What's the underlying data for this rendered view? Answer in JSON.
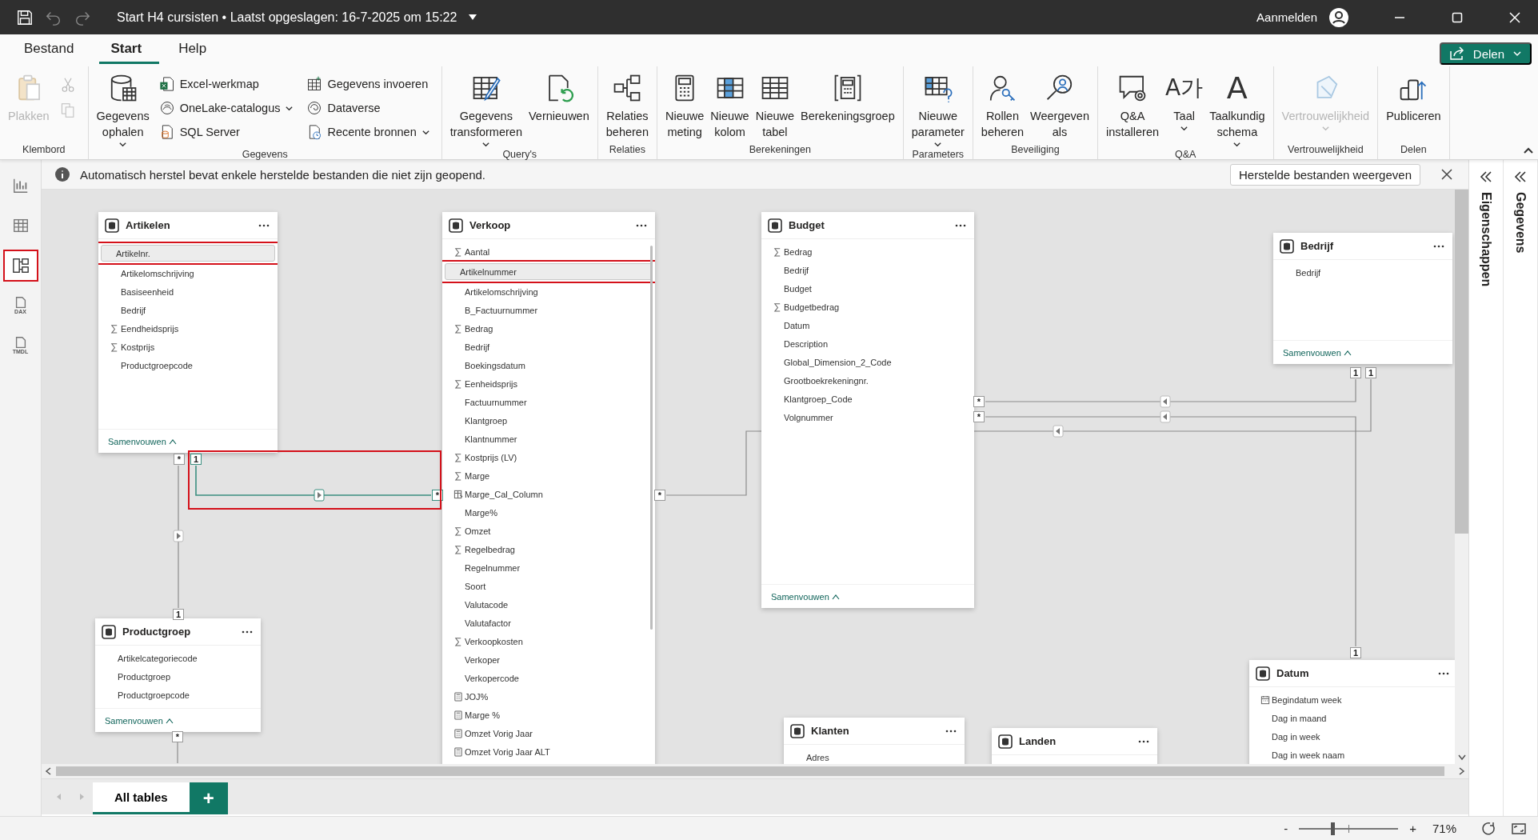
{
  "title_bar": {
    "title": "Start H4 cursisten • Laatst opgeslagen: 16-7-2025 om 15:22",
    "account": "Aanmelden"
  },
  "menu_tabs": [
    {
      "label": "Bestand",
      "selected": false
    },
    {
      "label": "Start",
      "selected": true
    },
    {
      "label": "Help",
      "selected": false
    }
  ],
  "share_button": "Delen",
  "ribbon": [
    {
      "label": "Klembord",
      "items": [
        {
          "kind": "large",
          "label": "Plakken",
          "disabled": true
        },
        {
          "kind": "column",
          "buttons": [
            {
              "disabled": true
            },
            {
              "disabled": true
            }
          ]
        }
      ]
    },
    {
      "label": "Gegevens",
      "items": [
        {
          "kind": "large",
          "label": "Gegevens\nophalen",
          "dropdown": true
        },
        {
          "kind": "column",
          "buttons": [
            {
              "label": "Excel-werkmap"
            },
            {
              "label": "OneLake-catalogus",
              "dropdown": true
            },
            {
              "label": "SQL Server"
            }
          ]
        },
        {
          "kind": "column",
          "buttons": [
            {
              "label": "Gegevens invoeren"
            },
            {
              "label": "Dataverse"
            },
            {
              "label": "Recente bronnen",
              "dropdown": true
            }
          ]
        }
      ]
    },
    {
      "label": "Query's",
      "items": [
        {
          "kind": "large",
          "label": "Gegevens\ntransformeren",
          "dropdown": true
        },
        {
          "kind": "large",
          "label": "Vernieuwen"
        }
      ]
    },
    {
      "label": "Relaties",
      "items": [
        {
          "kind": "large",
          "label": "Relaties\nbeheren"
        }
      ]
    },
    {
      "label": "Berekeningen",
      "items": [
        {
          "kind": "large",
          "label": "Nieuwe\nmeting"
        },
        {
          "kind": "large",
          "label": "Nieuwe\nkolom"
        },
        {
          "kind": "large",
          "label": "Nieuwe\ntabel"
        },
        {
          "kind": "large",
          "label": "Berekeningsgroep"
        }
      ]
    },
    {
      "label": "Parameters",
      "items": [
        {
          "kind": "large",
          "label": "Nieuwe\nparameter",
          "dropdown": true
        }
      ]
    },
    {
      "label": "Beveiliging",
      "items": [
        {
          "kind": "large",
          "label": "Rollen\nbeheren"
        },
        {
          "kind": "large",
          "label": "Weergeven\nals"
        }
      ]
    },
    {
      "label": "Q&A",
      "items": [
        {
          "kind": "large",
          "label": "Q&A\ninstalleren"
        },
        {
          "kind": "large",
          "label": "Taal",
          "glyph": "A가",
          "dropdown": true
        },
        {
          "kind": "large",
          "label": "Taalkundig\nschema",
          "glyph": "A",
          "dropdown": true
        }
      ]
    },
    {
      "label": "Vertrouwelijkheid",
      "items": [
        {
          "kind": "large",
          "label": "Vertrouwelijkheid",
          "dropdown": true,
          "disabled": true
        }
      ]
    },
    {
      "label": "Delen",
      "items": [
        {
          "kind": "large",
          "label": "Publiceren"
        }
      ]
    }
  ],
  "rail": [
    {
      "selected": false,
      "marked": false
    },
    {
      "selected": false,
      "marked": false
    },
    {
      "selected": true,
      "marked": true
    },
    {
      "label": "DAX",
      "selected": false,
      "marked": false
    },
    {
      "label": "TMDL",
      "selected": false,
      "marked": false
    }
  ],
  "notification": {
    "message": "Automatisch herstel bevat enkele herstelde bestanden die niet zijn geopend.",
    "action": "Herstelde bestanden weergeven"
  },
  "side_panels": [
    {
      "label": "Eigenschappen"
    },
    {
      "label": "Gegevens"
    }
  ],
  "tables": [
    {
      "name": "Artikelen",
      "collapse": "Samenvouwen",
      "fields": [
        {
          "name": "Artikelnr.",
          "kind": "plain",
          "selected": true,
          "marked": true
        },
        {
          "name": "Artikelomschrijving",
          "kind": "plain",
          "selected": false,
          "marked": false
        },
        {
          "name": "Basiseenheid",
          "kind": "plain",
          "selected": false,
          "marked": false
        },
        {
          "name": "Bedrijf",
          "kind": "plain",
          "selected": false,
          "marked": false
        },
        {
          "name": "Eendheidsprijs",
          "kind": "sum",
          "selected": false,
          "marked": false
        },
        {
          "name": "Kostprijs",
          "kind": "sum",
          "selected": false,
          "marked": false
        },
        {
          "name": "Productgroepcode",
          "kind": "plain",
          "selected": false,
          "marked": false
        }
      ]
    },
    {
      "name": "Verkoop",
      "fields": [
        {
          "name": "Aantal",
          "kind": "sum",
          "selected": false,
          "marked": false
        },
        {
          "name": "Artikelnummer",
          "kind": "plain",
          "selected": true,
          "marked": true
        },
        {
          "name": "Artikelomschrijving",
          "kind": "plain",
          "selected": false,
          "marked": false
        },
        {
          "name": "B_Factuurnummer",
          "kind": "plain",
          "selected": false,
          "marked": false
        },
        {
          "name": "Bedrag",
          "kind": "sum",
          "selected": false,
          "marked": false
        },
        {
          "name": "Bedrijf",
          "kind": "plain",
          "selected": false,
          "marked": false
        },
        {
          "name": "Boekingsdatum",
          "kind": "plain",
          "selected": false,
          "marked": false
        },
        {
          "name": "Eenheidsprijs",
          "kind": "sum",
          "selected": false,
          "marked": false
        },
        {
          "name": "Factuurnummer",
          "kind": "plain",
          "selected": false,
          "marked": false
        },
        {
          "name": "Klantgroep",
          "kind": "plain",
          "selected": false,
          "marked": false
        },
        {
          "name": "Klantnummer",
          "kind": "plain",
          "selected": false,
          "marked": false
        },
        {
          "name": "Kostprijs (LV)",
          "kind": "sum",
          "selected": false,
          "marked": false
        },
        {
          "name": "Marge",
          "kind": "sum",
          "selected": false,
          "marked": false
        },
        {
          "name": "Marge_Cal_Column",
          "kind": "calc",
          "selected": false,
          "marked": false
        },
        {
          "name": "Marge%",
          "kind": "plain",
          "selected": false,
          "marked": false
        },
        {
          "name": "Omzet",
          "kind": "sum",
          "selected": false,
          "marked": false
        },
        {
          "name": "Regelbedrag",
          "kind": "sum",
          "selected": false,
          "marked": false
        },
        {
          "name": "Regelnummer",
          "kind": "plain",
          "selected": false,
          "marked": false
        },
        {
          "name": "Soort",
          "kind": "plain",
          "selected": false,
          "marked": false
        },
        {
          "name": "Valutacode",
          "kind": "plain",
          "selected": false,
          "marked": false
        },
        {
          "name": "Valutafactor",
          "kind": "plain",
          "selected": false,
          "marked": false
        },
        {
          "name": "Verkoopkosten",
          "kind": "sum",
          "selected": false,
          "marked": false
        },
        {
          "name": "Verkoper",
          "kind": "plain",
          "selected": false,
          "marked": false
        },
        {
          "name": "Verkopercode",
          "kind": "plain",
          "selected": false,
          "marked": false
        },
        {
          "name": "JOJ%",
          "kind": "measure",
          "selected": false,
          "marked": false
        },
        {
          "name": "Marge %",
          "kind": "measure",
          "selected": false,
          "marked": false
        },
        {
          "name": "Omzet Vorig Jaar",
          "kind": "measure",
          "selected": false,
          "marked": false
        },
        {
          "name": "Omzet Vorig Jaar ALT",
          "kind": "measure",
          "selected": false,
          "marked": false
        }
      ]
    },
    {
      "name": "Budget",
      "collapse": "Samenvouwen",
      "fields": [
        {
          "name": "Bedrag",
          "kind": "sum",
          "selected": false,
          "marked": false
        },
        {
          "name": "Bedrijf",
          "kind": "plain",
          "selected": false,
          "marked": false
        },
        {
          "name": "Budget",
          "kind": "plain",
          "selected": false,
          "marked": false
        },
        {
          "name": "Budgetbedrag",
          "kind": "sum",
          "selected": false,
          "marked": false
        },
        {
          "name": "Datum",
          "kind": "plain",
          "selected": false,
          "marked": false
        },
        {
          "name": "Description",
          "kind": "plain",
          "selected": false,
          "marked": false
        },
        {
          "name": "Global_Dimension_2_Code",
          "kind": "plain",
          "selected": false,
          "marked": false
        },
        {
          "name": "Grootboekrekeningnr.",
          "kind": "plain",
          "selected": false,
          "marked": false
        },
        {
          "name": "Klantgroep_Code",
          "kind": "plain",
          "selected": false,
          "marked": false
        },
        {
          "name": "Volgnummer",
          "kind": "plain",
          "selected": false,
          "marked": false
        }
      ]
    },
    {
      "name": "Bedrijf",
      "collapse": "Samenvouwen",
      "fields": [
        {
          "name": "Bedrijf",
          "kind": "plain",
          "selected": false,
          "marked": false
        }
      ]
    },
    {
      "name": "Productgroep",
      "collapse": "Samenvouwen",
      "fields": [
        {
          "name": "Artikelcategoriecode",
          "kind": "plain",
          "selected": false,
          "marked": false
        },
        {
          "name": "Productgroep",
          "kind": "plain",
          "selected": false,
          "marked": false
        },
        {
          "name": "Productgroepcode",
          "kind": "plain",
          "selected": false,
          "marked": false
        }
      ]
    },
    {
      "name": "Klanten",
      "fields": [
        {
          "name": "Adres",
          "kind": "plain",
          "selected": false,
          "marked": false
        }
      ]
    },
    {
      "name": "Landen"
    },
    {
      "name": "Datum",
      "fields": [
        {
          "name": "Begindatum week",
          "kind": "date",
          "selected": false,
          "marked": false
        },
        {
          "name": "Dag in maand",
          "kind": "plain",
          "selected": false,
          "marked": false
        },
        {
          "name": "Dag in week",
          "kind": "plain",
          "selected": false,
          "marked": false
        },
        {
          "name": "Dag in week naam",
          "kind": "plain",
          "selected": false,
          "marked": false
        }
      ]
    }
  ],
  "relationships": [
    {
      "ends": [
        "*",
        "1"
      ],
      "selected": false,
      "marked": false
    },
    {
      "ends": [
        "1",
        "*"
      ],
      "selected": true,
      "marked": true
    },
    {
      "ends": [
        "*"
      ],
      "selected": false,
      "marked": false
    },
    {
      "ends": [
        "*",
        "1"
      ],
      "selected": false,
      "marked": false
    },
    {
      "ends": [
        "*",
        "1"
      ],
      "selected": false,
      "marked": false
    },
    {
      "ends": [
        "*",
        "1"
      ],
      "selected": false,
      "marked": false
    }
  ],
  "page_tabs": [
    {
      "label": "All tables",
      "selected": true
    }
  ],
  "add_tab": "+",
  "zoom": {
    "minus": "-",
    "plus": "+",
    "level": 0.34,
    "reading": "71%"
  }
}
